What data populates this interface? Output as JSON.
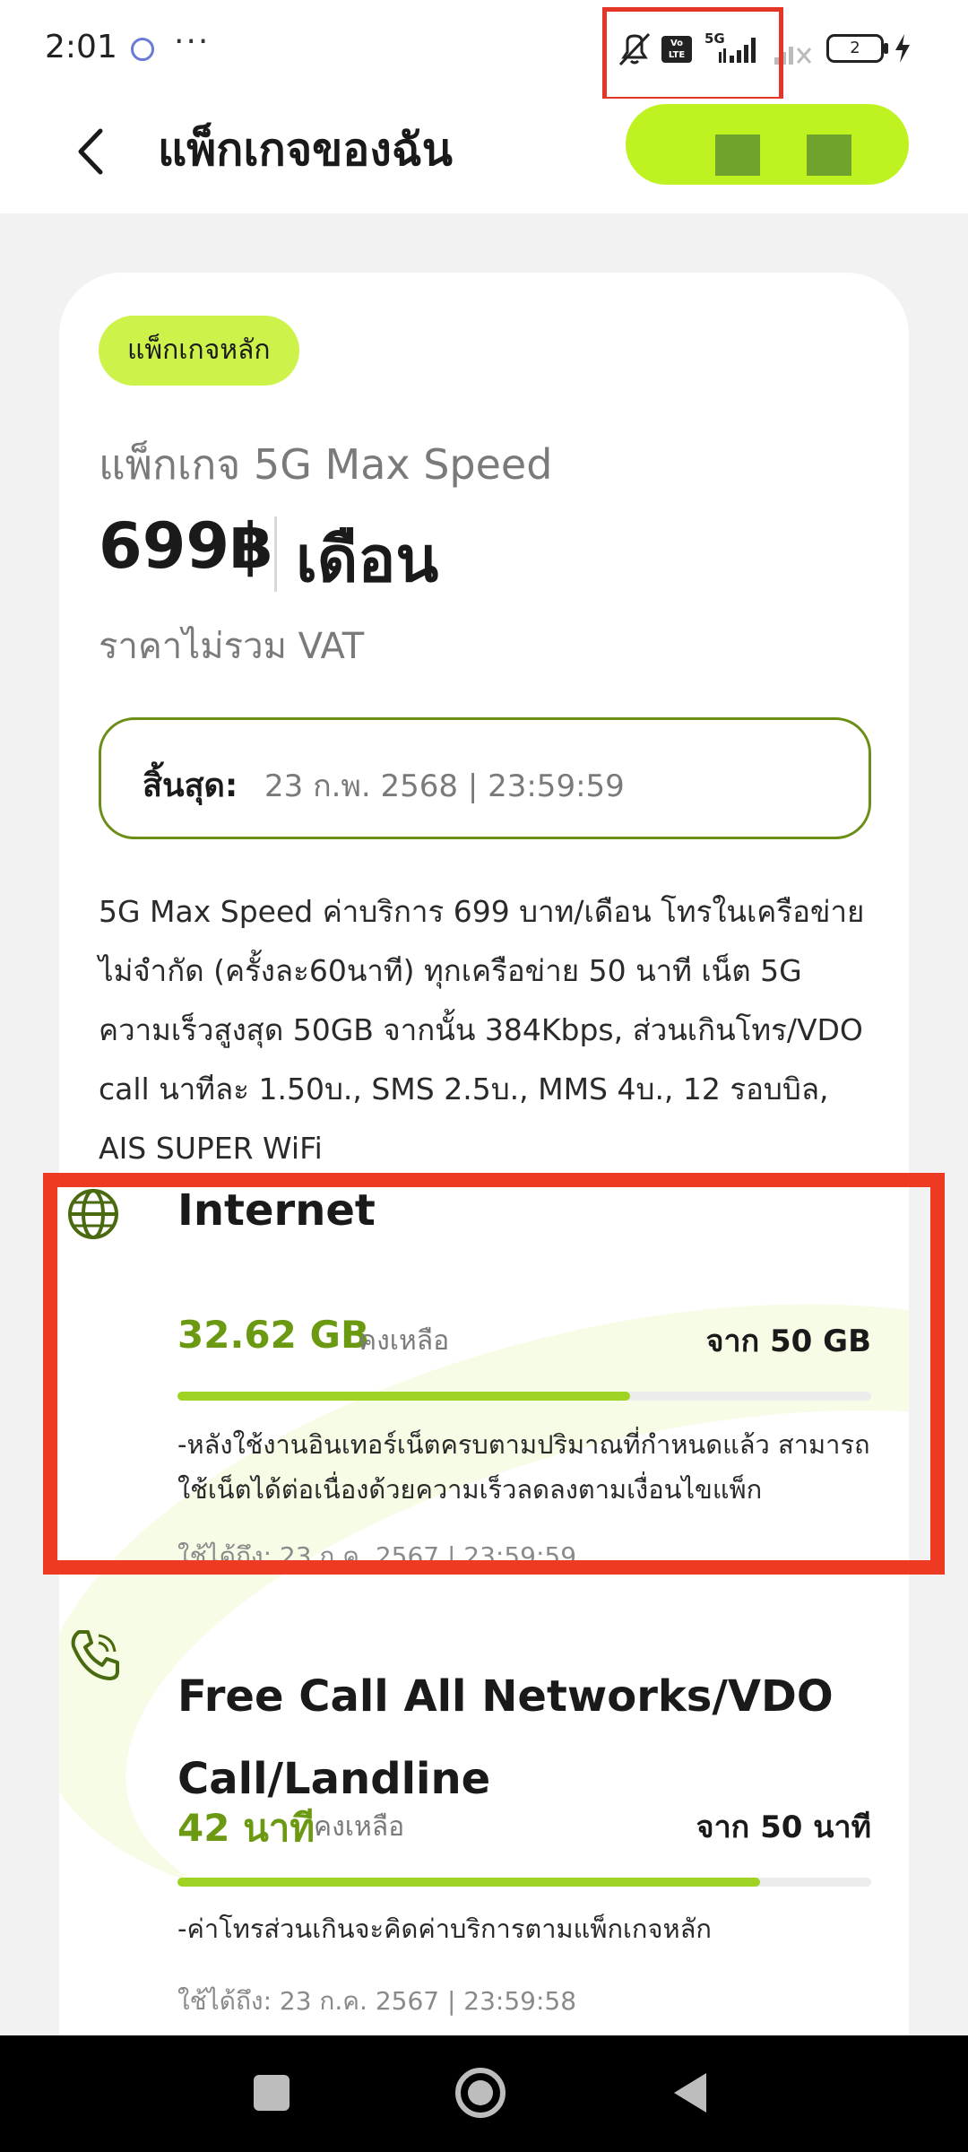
{
  "status_bar": {
    "time": "2:01",
    "more": "···",
    "network_type": "5G",
    "volte": "Vo LTE",
    "battery_level": "2",
    "icons": [
      "notification-app-icon",
      "mute-icon",
      "volte-icon",
      "signal-5g-icon",
      "signal-no-sim-icon",
      "battery-icon",
      "charging-icon"
    ]
  },
  "header": {
    "title": "แพ็กเกจของฉัน",
    "back_icon": "back-chevron-icon",
    "pill_color": "#bff221"
  },
  "package": {
    "badge": "แพ็กเกจหลัก",
    "name": "แพ็กเกจ 5G Max Speed",
    "price": "699฿",
    "price_unit": "เดือน",
    "vat_note": "ราคาไม่รวม VAT",
    "expiry_label": "สิ้นสุด:",
    "expiry_value": "23 ก.พ. 2568 | 23:59:59",
    "description": "5G Max Speed ค่าบริการ 699 บาท/เดือน โทรในเครือข่ายไม่จำกัด (ครั้งละ60นาที) ทุกเครือข่าย 50 นาที เน็ต 5G ความเร็วสูงสุด 50GB จากนั้น 384Kbps, ส่วนเกินโทร/VDO call นาทีละ 1.50บ., SMS 2.5บ., MMS 4บ., 12 รอบบิล, AIS SUPER WiFi"
  },
  "quotas": [
    {
      "icon": "globe-icon",
      "title": "Internet",
      "remaining": "32.62 GB",
      "remaining_label": "คงเหลือ",
      "total": "จาก 50 GB",
      "progress_fraction": 0.6524,
      "note": "-หลังใช้งานอินเทอร์เน็ตครบตามปริมาณที่กำหนดแล้ว สามารถใช้เน็ตได้ต่อเนื่องด้วยความเร็วลดลงตามเงื่อนไขแพ็ก",
      "valid_until": "ใช้ได้ถึง: 23 ก.ค. 2567 | 23:59:59"
    },
    {
      "icon": "phone-call-icon",
      "title": "Free Call All Networks/VDO Call/Landline",
      "remaining": "42 นาที",
      "remaining_label": "คงเหลือ",
      "total": "จาก 50 นาที",
      "progress_fraction": 0.84,
      "note": "-ค่าโทรส่วนเกินจะคิดค่าบริการตามแพ็กเกจหลัก",
      "valid_until": "ใช้ได้ถึง: 23 ก.ค. 2567 | 23:59:58"
    }
  ],
  "colors": {
    "accent_green": "#6b9a12",
    "progress_fill": "#9fd323",
    "badge_bg": "#cdf24a",
    "highlight_red": "#ee3a22"
  },
  "nav_bar": {
    "icons": [
      "recent-apps-icon",
      "home-icon",
      "back-icon"
    ]
  }
}
